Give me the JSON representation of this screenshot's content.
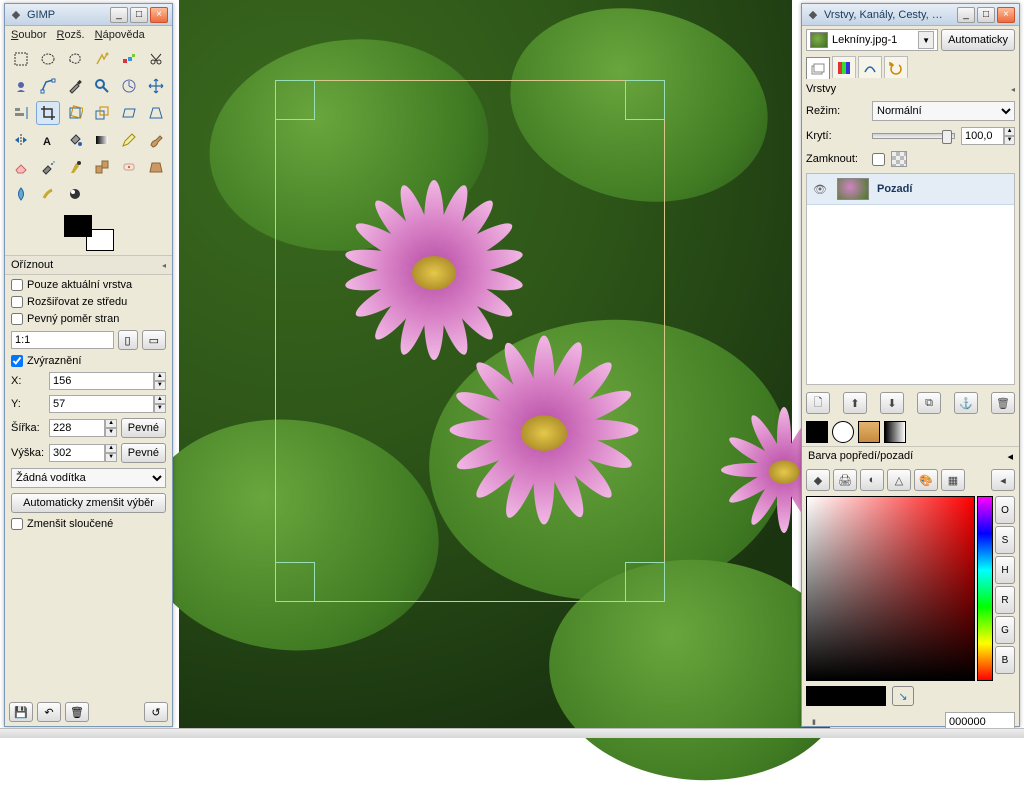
{
  "app": {
    "title": "GIMP"
  },
  "menu": {
    "file": "Soubor",
    "ext": "Rozš.",
    "help": "Nápověda"
  },
  "crop": {
    "header": "Oříznout",
    "only_current_layer": "Pouze aktuální vrstva",
    "expand_from_center": "Rozšiřovat ze středu",
    "fixed_aspect": "Pevný poměr stran",
    "ratio": "1:1",
    "highlight": "Zvýraznění",
    "x_label": "X:",
    "y_label": "Y:",
    "w_label": "Šířka:",
    "h_label": "Výška:",
    "x": "156",
    "y": "57",
    "w": "228",
    "h": "302",
    "fixed_btn": "Pevné",
    "no_guides": "Žádná vodítka",
    "autoshrink": "Automaticky zmenšit výběr",
    "shrink_merged": "Zmenšit sloučené"
  },
  "dock": {
    "title": "Vrstvy, Kanály, Cesty, …",
    "image_name": "Lekníny.jpg-1",
    "auto": "Automaticky",
    "layers_section": "Vrstvy",
    "mode_label": "Režim:",
    "mode_value": "Normální",
    "opacity_label": "Krytí:",
    "opacity_value": "100,0",
    "lock_label": "Zamknout:",
    "layer_name": "Pozadí",
    "fg_bg_label": "Barva popředí/pozadí",
    "hex": "000000",
    "modes": [
      "O",
      "S",
      "H",
      "R",
      "G",
      "B"
    ]
  }
}
